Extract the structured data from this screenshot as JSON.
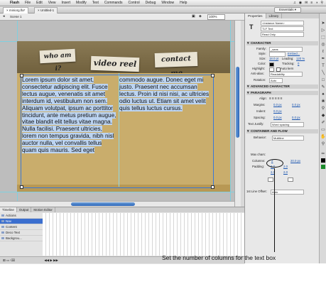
{
  "menubar": {
    "app": "Flash",
    "items": [
      "File",
      "Edit",
      "View",
      "Insert",
      "Modify",
      "Text",
      "Commands",
      "Control",
      "Debug",
      "Window",
      "Help"
    ],
    "right_icons": [
      "♫",
      "◉",
      "✉",
      "≡",
      "◑",
      "⚲"
    ]
  },
  "tabs": {
    "doc1": "miniorg.fla*",
    "doc2": "Untitled-1"
  },
  "workspace": {
    "label": "Essentials"
  },
  "editbar": {
    "scene": "Scene 1",
    "zoom": "100%"
  },
  "stage": {
    "papers": [
      "who am i?",
      "video reel",
      "contact me"
    ],
    "col1": "Lorem ipsum dolor sit amet, consectetur adipiscing elit. Fusce lectus augue, venenatis sit amet interdum id, vestibulum non sem. Aliquam volutpat, ipsum ac porttitor tincidunt, ante metus pretium augue, vitae blandit elit tellus vitae magna. Nulla facilisi. Praesent ultricies, lorem non tempus gravida, nibh nisl auctor nulla, vel convallis tellus quam quis mauris. Sed eget",
    "col2": "commodo augue. Donec eget mi justo. Praesent nec accumsan lectus. Proin id nisi nisi, ac ultricies odio luctus ut. Etiam sit amet velit quis tellus luctus cursus."
  },
  "timeline": {
    "tabs": [
      "Timeline",
      "Output",
      "Motion Editor"
    ],
    "layers": [
      "Actions",
      "Nav",
      "Content",
      "Deco Text",
      "Backgrou..."
    ],
    "selected_layer": "Nav"
  },
  "panel": {
    "tabs": [
      "Properties",
      "Library"
    ],
    "instance_name": "<Instance Name>",
    "text_engine": "TLF Text",
    "text_type": "Read Only",
    "sections": {
      "character": "CHARACTER",
      "advanced": "ADVANCED CHARACTER",
      "paragraph": "PARAGRAPH",
      "container": "CONTAINER AND FLOW"
    },
    "character": {
      "family_label": "Family:",
      "family": "_sans",
      "style_label": "Style:",
      "style": "Embed...",
      "size_label": "Size:",
      "size": "18.0 pt",
      "leading_label": "Leading:",
      "leading": "120 %",
      "color_label": "Color:",
      "tracking_label": "Tracking:",
      "tracking": "0",
      "highlight_label": "Highlight:",
      "autokern": "Auto kern",
      "aa_label": "Anti-alias:",
      "aa": "Readability",
      "rotation_label": "Rotation:",
      "rotation": "Auto"
    },
    "paragraph": {
      "align_label": "Align:",
      "margins_label": "Margins:",
      "margins_a": "0.0 px",
      "margins_b": "0.0 px",
      "indent_label": "Indent:",
      "indent": "0.0 px",
      "spacing_label": "Spacing:",
      "spacing_a": "0.0 px",
      "spacing_b": "0.0 px",
      "justify_label": "Text Justify:",
      "justify": "Word spacing"
    },
    "container": {
      "behavior_label": "Behavior:",
      "behavior": "Multiline",
      "maxchars_label": "Max chars:",
      "columns_label": "Columns:",
      "columns": "2",
      "columns_gap": "20.0 px",
      "padding_label": "Padding:",
      "padding_a": "2.0",
      "padding_b": "2.0",
      "padding_c": "2.0",
      "padding_d": "2.0",
      "list_label": "1st Line Offset:",
      "list_value": "Auto"
    }
  },
  "annotation": {
    "caption": "Set the number of columns for the text box"
  }
}
